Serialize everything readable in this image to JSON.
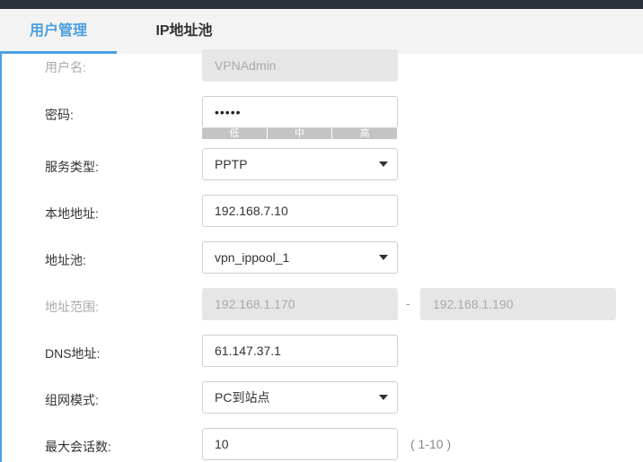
{
  "tabs": [
    {
      "label": "用户管理"
    },
    {
      "label": "IP地址池"
    }
  ],
  "form": {
    "username": {
      "label": "用户名:",
      "value": "VPNAdmin"
    },
    "password": {
      "label": "密码:",
      "value": "•••••",
      "strength": [
        "低",
        "中",
        "高"
      ]
    },
    "service_type": {
      "label": "服务类型:",
      "value": "PPTP"
    },
    "local_address": {
      "label": "本地地址:",
      "value": "192.168.7.10"
    },
    "address_pool": {
      "label": "地址池:",
      "value": "vpn_ippool_1"
    },
    "address_range": {
      "label": "地址范围:",
      "start": "192.168.1.170",
      "separator": "-",
      "end": "192.168.1.190"
    },
    "dns_address": {
      "label": "DNS地址:",
      "value": "61.147.37.1"
    },
    "network_mode": {
      "label": "组网模式:",
      "value": "PC到站点"
    },
    "max_sessions": {
      "label": "最大会话数:",
      "value": "10",
      "hint": "( 1-10 )"
    }
  },
  "colors": {
    "accent": "#4a9fe0",
    "topbar": "#2b2f3a",
    "disabled_bg": "#e6e6e6"
  },
  "icons": {
    "select_arrow": "caret-down-icon"
  }
}
